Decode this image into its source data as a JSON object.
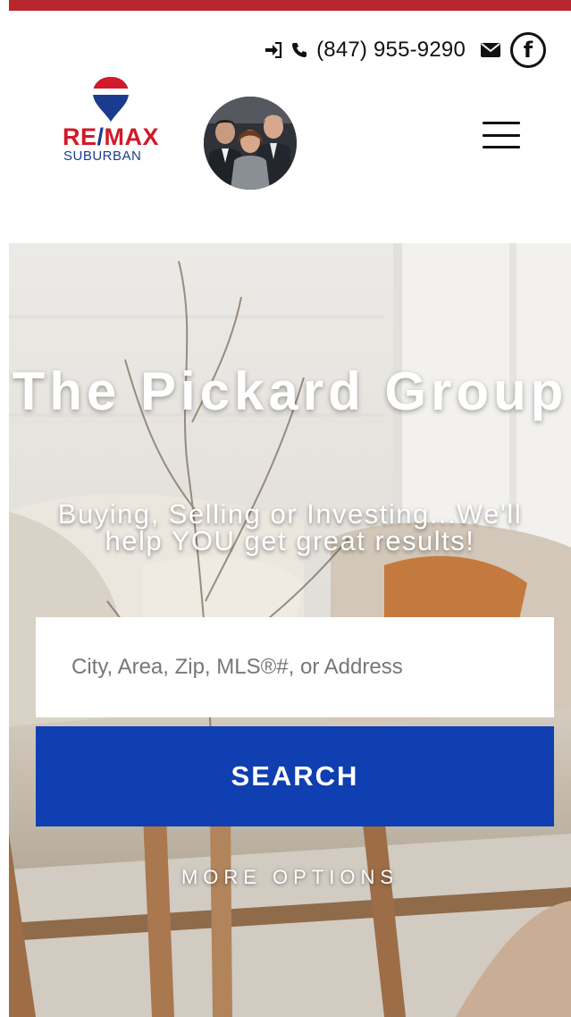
{
  "header": {
    "stripe_color": "#b8262e",
    "phone": "(847) 955-9290",
    "icons": {
      "login": "sign-in-icon",
      "phone": "phone-icon",
      "email": "envelope-icon",
      "social": "facebook-icon"
    },
    "facebook_glyph": "f",
    "logo": {
      "brand": "RE/MAX",
      "sub": "SUBURBAN"
    },
    "menu_icon": "hamburger-icon"
  },
  "hero": {
    "title": "The Pickard Group",
    "subtitle": "Buying, Selling or Investing...We'll help YOU get great results!",
    "search": {
      "placeholder": "City, Area, Zip, MLS®#, or Address",
      "value": ""
    },
    "search_button": "SEARCH",
    "more_options": "MORE OPTIONS",
    "button_color": "#0f3fb0"
  }
}
